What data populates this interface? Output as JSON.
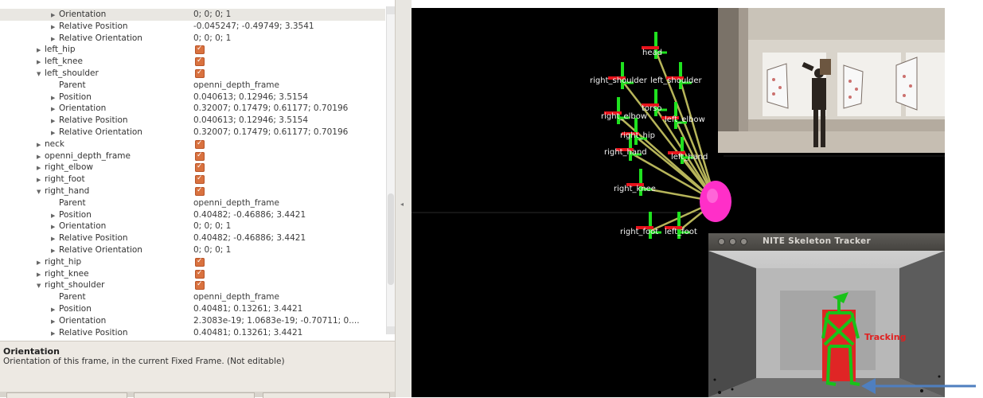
{
  "tree": {
    "rows": [
      {
        "indent": 3,
        "arrow": "right",
        "name": "Orientation",
        "value": "0; 0; 0; 1",
        "selected": true
      },
      {
        "indent": 3,
        "arrow": "right",
        "name": "Relative Position",
        "value": "-0.045247; -0.49749; 3.3541"
      },
      {
        "indent": 3,
        "arrow": "right",
        "name": "Relative Orientation",
        "value": "0; 0; 0; 1"
      },
      {
        "indent": 2,
        "arrow": "right",
        "name": "left_hip",
        "checkbox": true
      },
      {
        "indent": 2,
        "arrow": "right",
        "name": "left_knee",
        "checkbox": true
      },
      {
        "indent": 2,
        "arrow": "down",
        "name": "left_shoulder",
        "checkbox": true
      },
      {
        "indent": 3,
        "arrow": "none",
        "name": "Parent",
        "value": "openni_depth_frame"
      },
      {
        "indent": 3,
        "arrow": "right",
        "name": "Position",
        "value": "0.040613; 0.12946; 3.5154"
      },
      {
        "indent": 3,
        "arrow": "right",
        "name": "Orientation",
        "value": "0.32007; 0.17479; 0.61177; 0.70196"
      },
      {
        "indent": 3,
        "arrow": "right",
        "name": "Relative Position",
        "value": "0.040613; 0.12946; 3.5154"
      },
      {
        "indent": 3,
        "arrow": "right",
        "name": "Relative Orientation",
        "value": "0.32007; 0.17479; 0.61177; 0.70196"
      },
      {
        "indent": 2,
        "arrow": "right",
        "name": "neck",
        "checkbox": true
      },
      {
        "indent": 2,
        "arrow": "right",
        "name": "openni_depth_frame",
        "checkbox": true
      },
      {
        "indent": 2,
        "arrow": "right",
        "name": "right_elbow",
        "checkbox": true
      },
      {
        "indent": 2,
        "arrow": "right",
        "name": "right_foot",
        "checkbox": true
      },
      {
        "indent": 2,
        "arrow": "down",
        "name": "right_hand",
        "checkbox": true
      },
      {
        "indent": 3,
        "arrow": "none",
        "name": "Parent",
        "value": "openni_depth_frame"
      },
      {
        "indent": 3,
        "arrow": "right",
        "name": "Position",
        "value": "0.40482; -0.46886; 3.4421"
      },
      {
        "indent": 3,
        "arrow": "right",
        "name": "Orientation",
        "value": "0; 0; 0; 1"
      },
      {
        "indent": 3,
        "arrow": "right",
        "name": "Relative Position",
        "value": "0.40482; -0.46886; 3.4421"
      },
      {
        "indent": 3,
        "arrow": "right",
        "name": "Relative Orientation",
        "value": "0; 0; 0; 1"
      },
      {
        "indent": 2,
        "arrow": "right",
        "name": "right_hip",
        "checkbox": true
      },
      {
        "indent": 2,
        "arrow": "right",
        "name": "right_knee",
        "checkbox": true
      },
      {
        "indent": 2,
        "arrow": "down",
        "name": "right_shoulder",
        "checkbox": true
      },
      {
        "indent": 3,
        "arrow": "none",
        "name": "Parent",
        "value": "openni_depth_frame"
      },
      {
        "indent": 3,
        "arrow": "right",
        "name": "Position",
        "value": "0.40481; 0.13261; 3.4421"
      },
      {
        "indent": 3,
        "arrow": "right",
        "name": "Orientation",
        "value": "2.3083e-19; 1.0683e-19; -0.70711; 0...."
      },
      {
        "indent": 3,
        "arrow": "right",
        "name": "Relative Position",
        "value": "0.40481; 0.13261; 3.4421"
      }
    ]
  },
  "description": {
    "title": "Orientation",
    "text": "Orientation of this frame, in the current Fixed Frame. (Not editable)"
  },
  "view3d": {
    "frame_labels": [
      "head",
      "right_shoulder",
      "left_shoulder",
      "torso",
      "right_elbow",
      "left_elbow",
      "right_hip",
      "right_hand",
      "left_hand",
      "right_knee",
      "right_foot",
      "left_foot"
    ],
    "colors": {
      "background": "#000000",
      "axis_x": "#e8141c",
      "axis_y": "#1fe21f",
      "link": "#b7b55a",
      "origin": "#ff2fc8",
      "label": "#f2f2f2"
    }
  },
  "nite": {
    "title": "NITE Skeleton Tracker",
    "status": "Tracking",
    "colors": {
      "skeleton_green": "#19c219",
      "skeleton_red": "#e02525",
      "status": "#e02020"
    }
  },
  "annotation": {
    "arrow_color": "#4f7fbf"
  }
}
